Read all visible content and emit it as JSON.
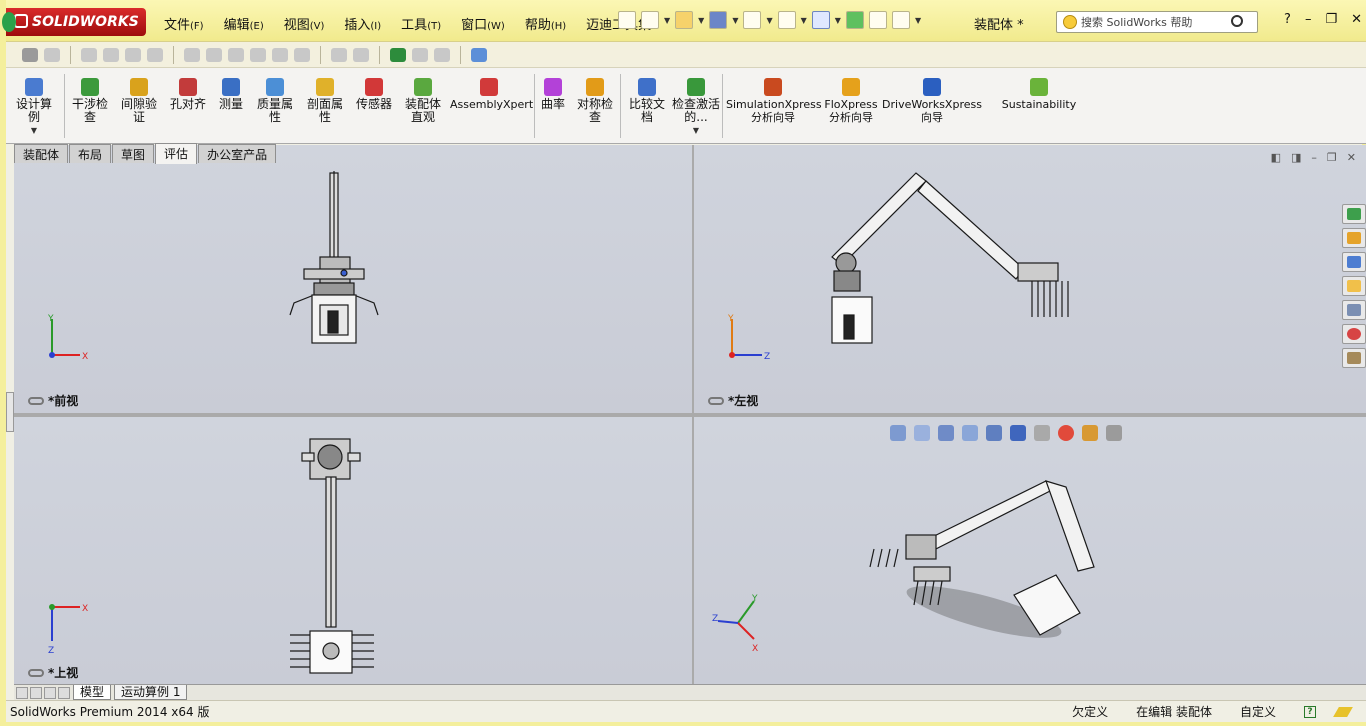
{
  "app": {
    "brand": "SOLIDWORKS",
    "document_title": "装配体 *"
  },
  "menu": [
    {
      "label": "文件",
      "key": "(F)"
    },
    {
      "label": "编辑",
      "key": "(E)"
    },
    {
      "label": "视图",
      "key": "(V)"
    },
    {
      "label": "插入",
      "key": "(I)"
    },
    {
      "label": "工具",
      "key": "(T)"
    },
    {
      "label": "窗口",
      "key": "(W)"
    },
    {
      "label": "帮助",
      "key": "(H)"
    },
    {
      "label": "迈迪工具集",
      "key": ""
    }
  ],
  "search": {
    "placeholder": "搜索 SolidWorks 帮助"
  },
  "ribbon": {
    "buttons": [
      {
        "label": "设计算例",
        "color": "#4a7bd0"
      },
      {
        "label": "干涉检查",
        "color": "#3c9a3c"
      },
      {
        "label": "间隙验证",
        "color": "#d9a21c"
      },
      {
        "label": "孔对齐",
        "color": "#c23b3b"
      },
      {
        "label": "测量",
        "color": "#3a6fc4"
      },
      {
        "label": "质量属性",
        "color": "#4c8fd6"
      },
      {
        "label": "剖面属性",
        "color": "#e0b12a"
      },
      {
        "label": "传感器",
        "color": "#d23838"
      },
      {
        "label": "装配体直观",
        "color": "#5aa83f"
      },
      {
        "label": "AssemblyXpert",
        "color": "#d13a3a"
      },
      {
        "label": "曲率",
        "color": "#b341d8"
      },
      {
        "label": "对称检查",
        "color": "#e29b18"
      },
      {
        "label": "比较文档",
        "color": "#3f70c9"
      },
      {
        "label": "检查激活的...",
        "color": "#39983b"
      },
      {
        "label": "SimulationXpress 分析向导",
        "color": "#c94a1f"
      },
      {
        "label": "FloXpress 分析向导",
        "color": "#e5a11b"
      },
      {
        "label": "DriveWorksXpress 向导",
        "color": "#2b5fc0"
      },
      {
        "label": "Sustainability",
        "color": "#6ab33a"
      }
    ]
  },
  "command_tabs": [
    {
      "label": "装配体",
      "active": false
    },
    {
      "label": "布局",
      "active": false
    },
    {
      "label": "草图",
      "active": false
    },
    {
      "label": "评估",
      "active": true
    },
    {
      "label": "办公室产品",
      "active": false
    }
  ],
  "viewports": [
    {
      "label": "*前视",
      "axis_h": "X",
      "axis_v": "Y"
    },
    {
      "label": "*左视",
      "axis_h": "Z",
      "axis_v": "Y"
    },
    {
      "label": "*上视",
      "axis_h": "X",
      "axis_v": "Z"
    },
    {
      "label": "",
      "axis_h": "Y",
      "axis_v": "Z"
    }
  ],
  "sheet_tabs": [
    {
      "label": "模型",
      "active": true
    },
    {
      "label": "运动算例 1",
      "active": false
    }
  ],
  "status": {
    "product": "SolidWorks Premium 2014 x64 版",
    "items": [
      "欠定义",
      "在编辑 装配体",
      "自定义"
    ]
  }
}
